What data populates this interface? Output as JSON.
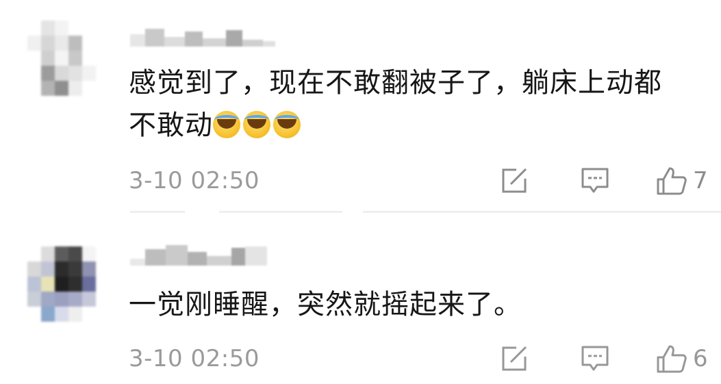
{
  "comments": [
    {
      "text_line1": "感觉到了，现在不敢翻被子了，躺床上动都",
      "text_line2": "不敢动",
      "emojis": [
        "crying-laughing",
        "crying-laughing",
        "crying-laughing"
      ],
      "time": "3-10 02:50",
      "likes": "7"
    },
    {
      "text_line1": "一觉刚睡醒，突然就摇起来了。",
      "time": "3-10 02:50",
      "likes": "6"
    }
  ],
  "icons": {
    "repost": "repost-icon",
    "comment": "comment-icon",
    "like": "thumbs-up-icon"
  },
  "colors": {
    "text": "#161616",
    "meta": "#9a9a9a",
    "icon": "#8c8c8c",
    "emoji": "#f7c331"
  }
}
